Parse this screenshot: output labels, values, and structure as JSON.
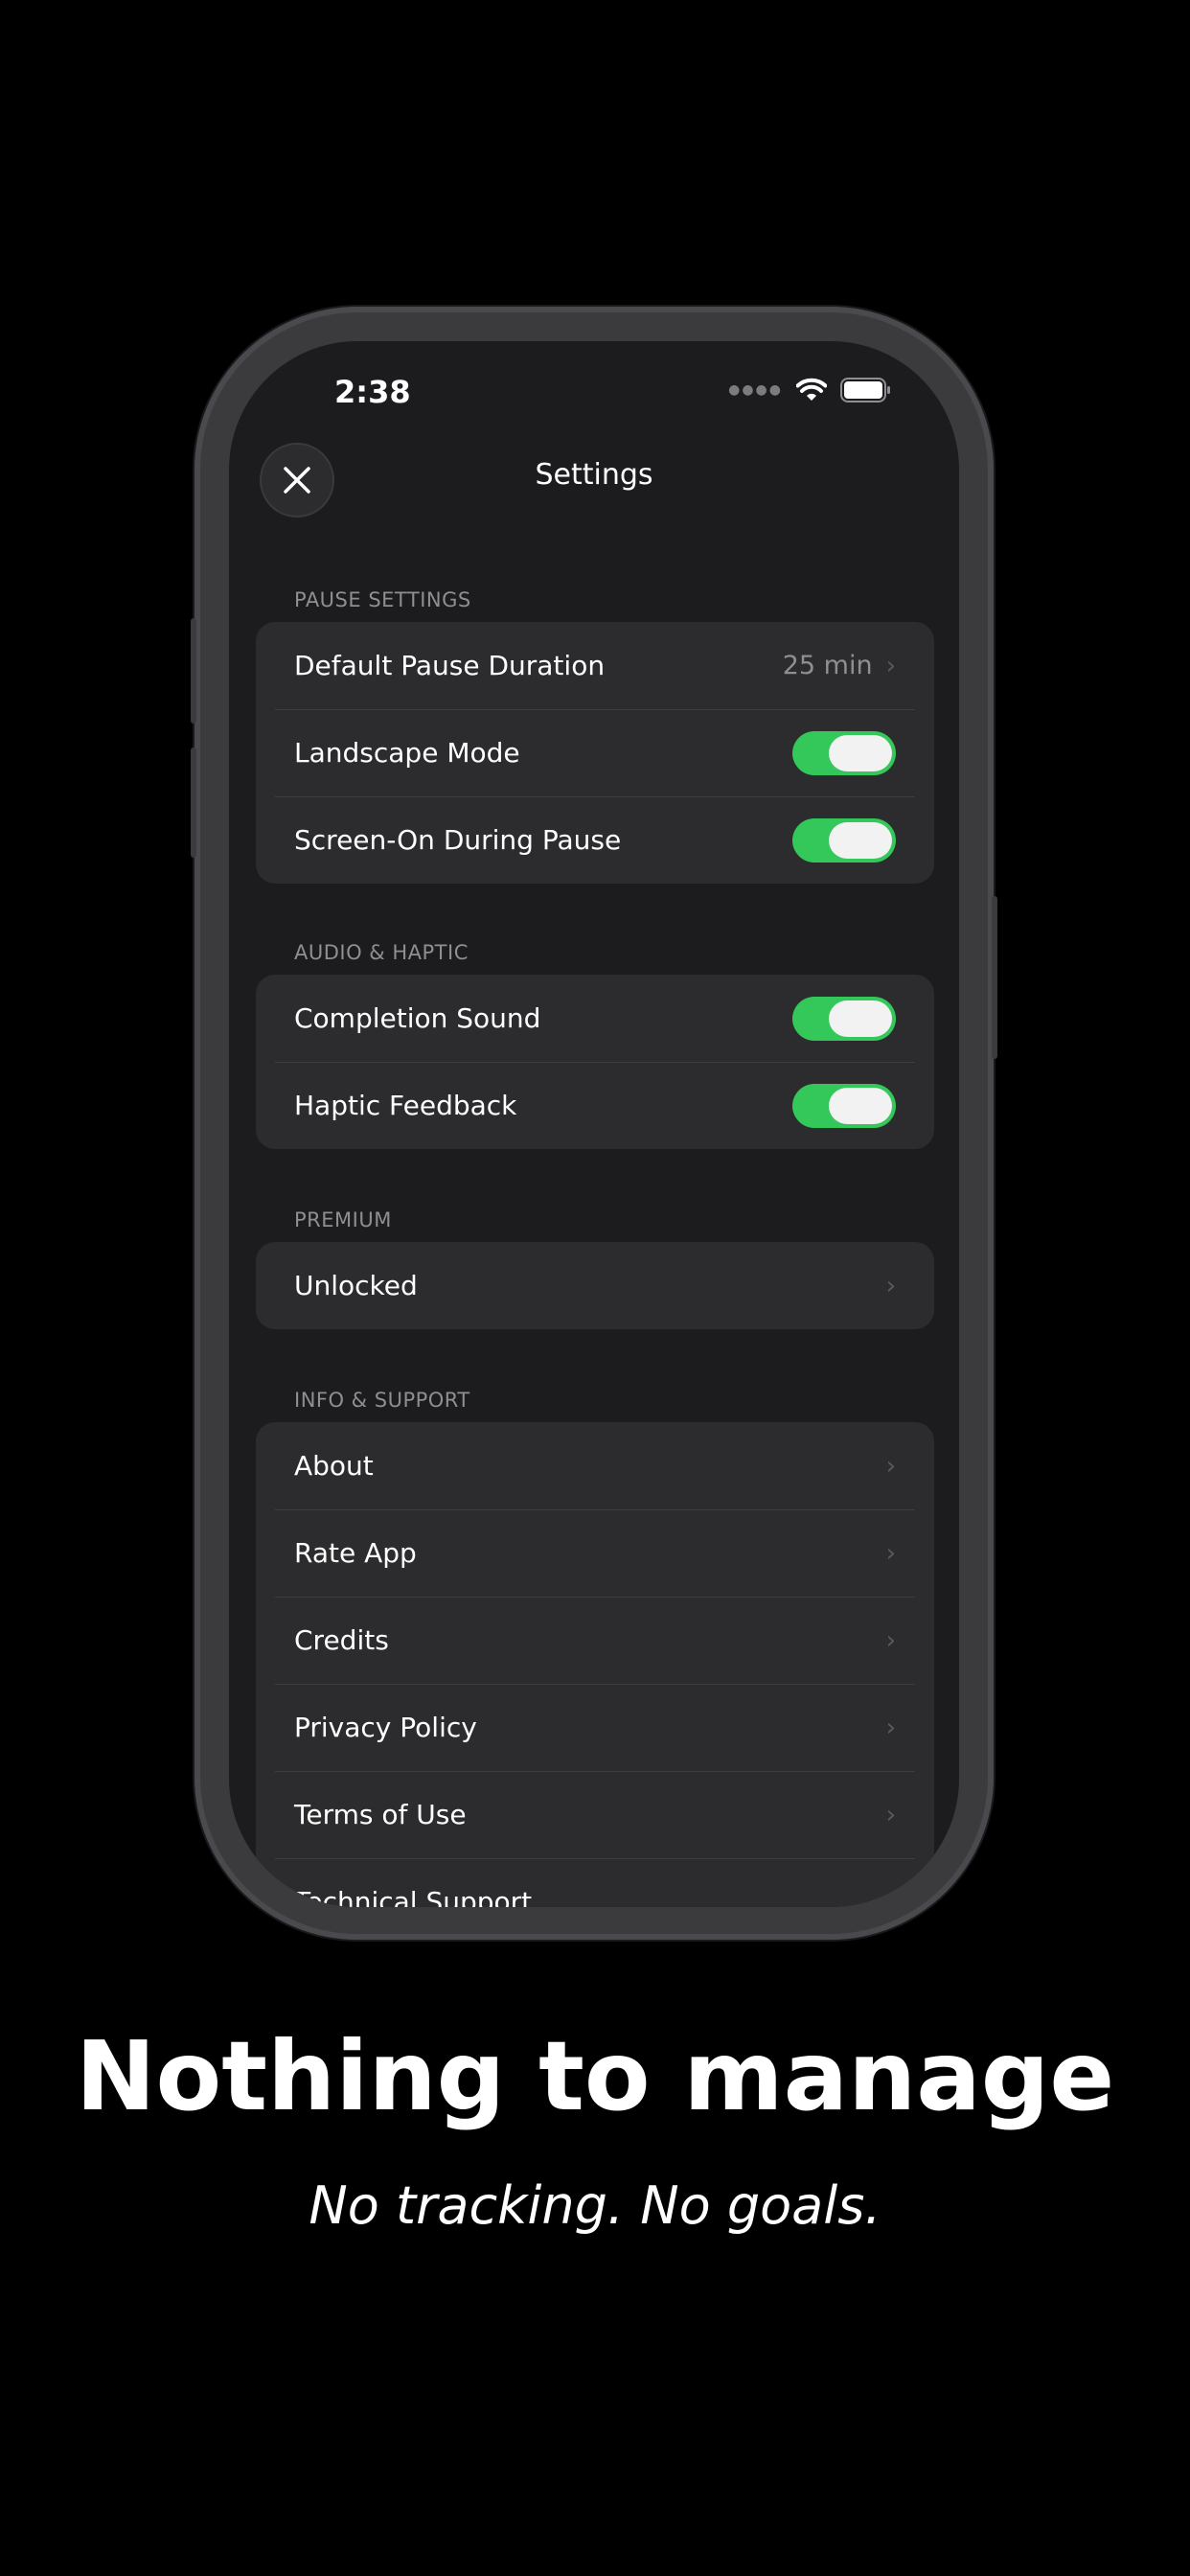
{
  "status_bar": {
    "time": "2:38",
    "signal_icon": "signal-dots-icon",
    "wifi_icon": "wifi-icon",
    "battery_icon": "battery-icon"
  },
  "nav": {
    "title": "Settings",
    "close_icon": "close-icon"
  },
  "sections": {
    "pause": {
      "header": "PAUSE SETTINGS",
      "default_pause_label": "Default Pause Duration",
      "default_pause_value": "25 min",
      "landscape_label": "Landscape Mode",
      "landscape_on": true,
      "screen_on_label": "Screen-On During Pause",
      "screen_on_on": true
    },
    "audio": {
      "header": "AUDIO & HAPTIC",
      "completion_label": "Completion Sound",
      "completion_on": true,
      "haptic_label": "Haptic Feedback",
      "haptic_on": true
    },
    "premium": {
      "header": "PREMIUM",
      "unlocked_label": "Unlocked"
    },
    "info": {
      "header": "INFO & SUPPORT",
      "items": [
        "About",
        "Rate App",
        "Credits",
        "Privacy Policy",
        "Terms of Use",
        "Technical Support"
      ]
    }
  },
  "promo": {
    "headline": "Nothing to manage",
    "subline": "No tracking. No goals."
  },
  "colors": {
    "toggle_on": "#34c759",
    "group_bg": "#2c2c2e",
    "screen_bg": "#1c1c1e"
  }
}
